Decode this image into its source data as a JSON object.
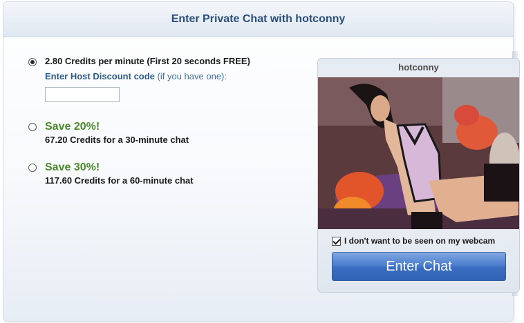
{
  "dialog": {
    "title": "Enter Private Chat with hotconny"
  },
  "options": [
    {
      "label": "2.80 Credits per minute (First 20 seconds FREE)",
      "selected": true,
      "discount_label": "Enter Host Discount code",
      "discount_hint": "(if you have one):",
      "discount_value": ""
    },
    {
      "save_label": "Save 20%!",
      "description": "67.20 Credits for a 30-minute chat",
      "selected": false
    },
    {
      "save_label": "Save 30%!",
      "description": "117.60 Credits for a 60-minute chat",
      "selected": false
    }
  ],
  "host": {
    "name": "hotconny",
    "hide_webcam_label": "I don't want to be seen on my webcam",
    "hide_webcam_checked": true,
    "enter_button": "Enter Chat"
  },
  "colors": {
    "title": "#2b4f78",
    "save": "#4b8a2c",
    "discount_label": "#2b5a8a",
    "button": "#3a6dc0"
  }
}
